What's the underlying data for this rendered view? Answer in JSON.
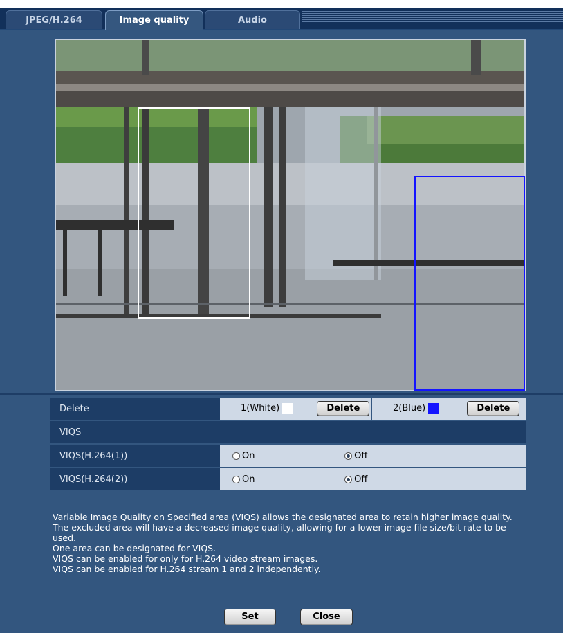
{
  "tabs": [
    {
      "label": "JPEG/H.264",
      "active": false
    },
    {
      "label": "Image quality",
      "active": true
    },
    {
      "label": "Audio",
      "active": false
    }
  ],
  "areas": {
    "white": {
      "name": "1(White)",
      "color": "#ffffff",
      "delete_label": "Delete"
    },
    "blue": {
      "name": "2(Blue)",
      "color": "#1414ff",
      "delete_label": "Delete"
    }
  },
  "settings": {
    "delete_label": "Delete",
    "viqs_header": "VIQS",
    "rows": [
      {
        "label": "VIQS(H.264(1))",
        "on_label": "On",
        "off_label": "Off",
        "selected": "Off"
      },
      {
        "label": "VIQS(H.264(2))",
        "on_label": "On",
        "off_label": "Off",
        "selected": "Off"
      }
    ]
  },
  "description": [
    "Variable Image Quality on Specified area (VIQS) allows the designated area to retain higher image quality.",
    "The excluded area will have a decreased image quality, allowing for a lower image file size/bit rate to be used.",
    "One area can be designated for VIQS.",
    "VIQS can be enabled for only for H.264 video stream images.",
    "VIQS can be enabled for H.264 stream 1 and 2 independently."
  ],
  "buttons": {
    "set": "Set",
    "close": "Close"
  }
}
